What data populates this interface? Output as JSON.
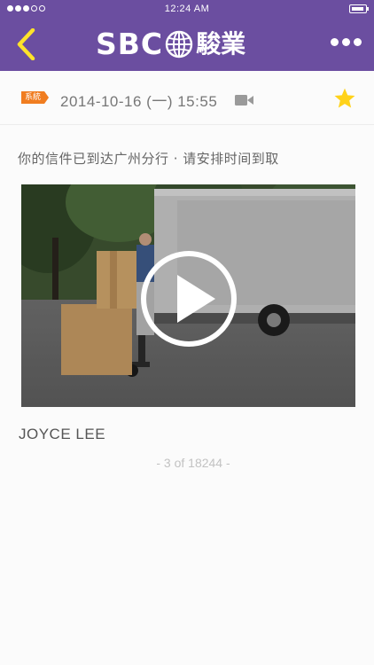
{
  "status_bar": {
    "time": "12:24 AM"
  },
  "header": {
    "logo_text": "SBC",
    "logo_chinese": "駿業"
  },
  "meta": {
    "tag": "系統",
    "datetime": "2014-10-16 (一)  15:55"
  },
  "message": {
    "text": "你的信件已到达广州分行 · 请安排时间到取"
  },
  "author": "JOYCE LEE",
  "pager": "- 3 of 18244 -",
  "colors": {
    "header": "#6b4ea0",
    "back_arrow": "#ffe22a",
    "tag": "#f07d20",
    "star": "#ffd21a"
  }
}
